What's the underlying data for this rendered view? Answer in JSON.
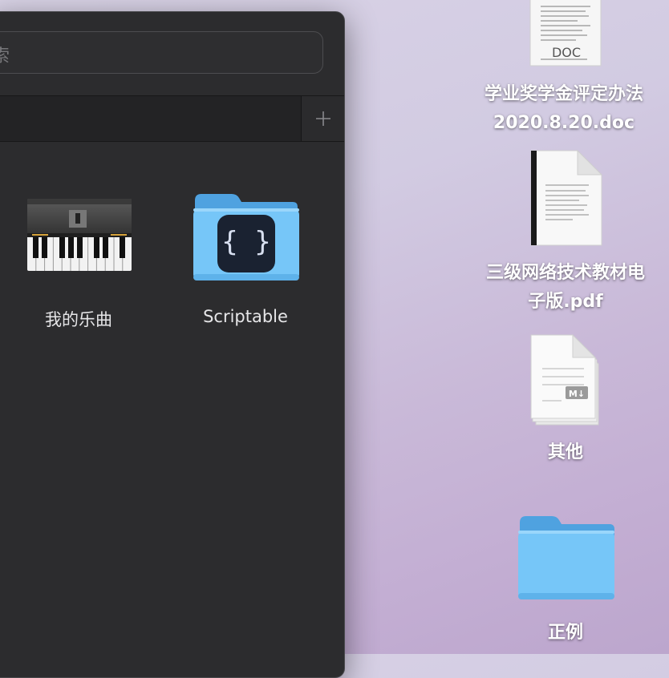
{
  "finder": {
    "search": {
      "placeholder": "索"
    },
    "items": [
      {
        "label": "我的乐曲",
        "icon": "piano-app-icon"
      },
      {
        "label": "Scriptable",
        "icon": "folder-scriptable-icon"
      }
    ]
  },
  "desktop": {
    "items": [
      {
        "line1": "学业奖学金评定办法",
        "line2": "2020.8.20.doc",
        "icon": "doc-file-icon",
        "badge": "DOC"
      },
      {
        "line1": "三级网络技术教材电",
        "line2": "子版.pdf",
        "icon": "pdf-file-icon"
      },
      {
        "line1": "其他",
        "icon": "markdown-files-icon",
        "badge": "M↓"
      },
      {
        "line1": "正例",
        "icon": "folder-icon"
      }
    ]
  },
  "colors": {
    "window_bg": "#2c2c2e",
    "folder_blue": "#6fc3f6",
    "wallpaper": "#cbbfdc"
  }
}
